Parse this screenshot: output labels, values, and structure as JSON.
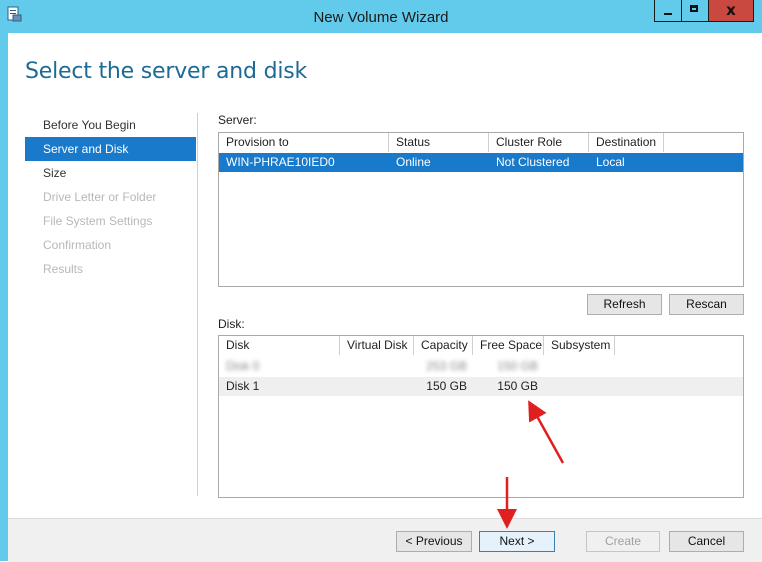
{
  "window": {
    "title": "New Volume Wizard",
    "accent_color": "#62cbec",
    "close_color": "#c9483f",
    "close_glyph": "x"
  },
  "page": {
    "heading": "Select the server and disk"
  },
  "nav": {
    "items": [
      {
        "label": "Before You Begin",
        "state": "normal"
      },
      {
        "label": "Server and Disk",
        "state": "active"
      },
      {
        "label": "Size",
        "state": "normal"
      },
      {
        "label": "Drive Letter or Folder",
        "state": "disabled"
      },
      {
        "label": "File System Settings",
        "state": "disabled"
      },
      {
        "label": "Confirmation",
        "state": "disabled"
      },
      {
        "label": "Results",
        "state": "disabled"
      }
    ]
  },
  "server": {
    "label": "Server:",
    "columns": [
      "Provision to",
      "Status",
      "Cluster Role",
      "Destination"
    ],
    "rows": [
      {
        "provision_to": "WIN-PHRAE10IED0",
        "status": "Online",
        "cluster_role": "Not Clustered",
        "destination": "Local",
        "selected": true
      }
    ],
    "refresh_label": "Refresh",
    "rescan_label": "Rescan"
  },
  "disk": {
    "label": "Disk:",
    "columns": [
      "Disk",
      "Virtual Disk",
      "Capacity",
      "Free Space",
      "Subsystem"
    ],
    "rows": [
      {
        "disk": "Disk 0",
        "virtual_disk": "",
        "capacity": "253 GB",
        "free_space": "150 GB",
        "subsystem": "",
        "obscured": true
      },
      {
        "disk": "Disk 1",
        "virtual_disk": "",
        "capacity": "150 GB",
        "free_space": "150 GB",
        "subsystem": "",
        "obscured": false
      }
    ]
  },
  "footer": {
    "previous_label": "< Previous",
    "next_label": "Next >",
    "create_label": "Create",
    "cancel_label": "Cancel"
  },
  "annotations": {
    "arrow_color": "#e02020"
  }
}
